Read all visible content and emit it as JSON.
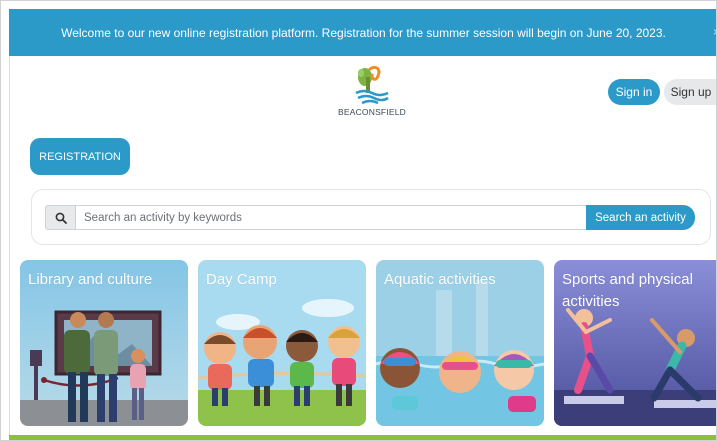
{
  "banner": {
    "message": "Welcome to our new online registration platform. Registration for the summer session will begin on June 20, 2023.",
    "close_glyph": "×"
  },
  "header": {
    "brand": "BEACONSFIELD",
    "signin_label": "Sign in",
    "signup_label": "Sign up"
  },
  "registration_label": "REGISTRATION",
  "search": {
    "placeholder": "Search an activity by keywords",
    "value": "",
    "button_label": "Search an activity",
    "icon": "search-icon"
  },
  "categories": [
    {
      "label": "Library and culture",
      "icon": "library-illustration"
    },
    {
      "label": "Day Camp",
      "icon": "kids-illustration"
    },
    {
      "label": "Aquatic activities",
      "icon": "swimmers-illustration"
    },
    {
      "label": "Sports and physical activities",
      "icon": "stretching-illustration"
    }
  ],
  "colors": {
    "accent": "#2b9ac8",
    "footer_green": "#8dbf3a"
  }
}
